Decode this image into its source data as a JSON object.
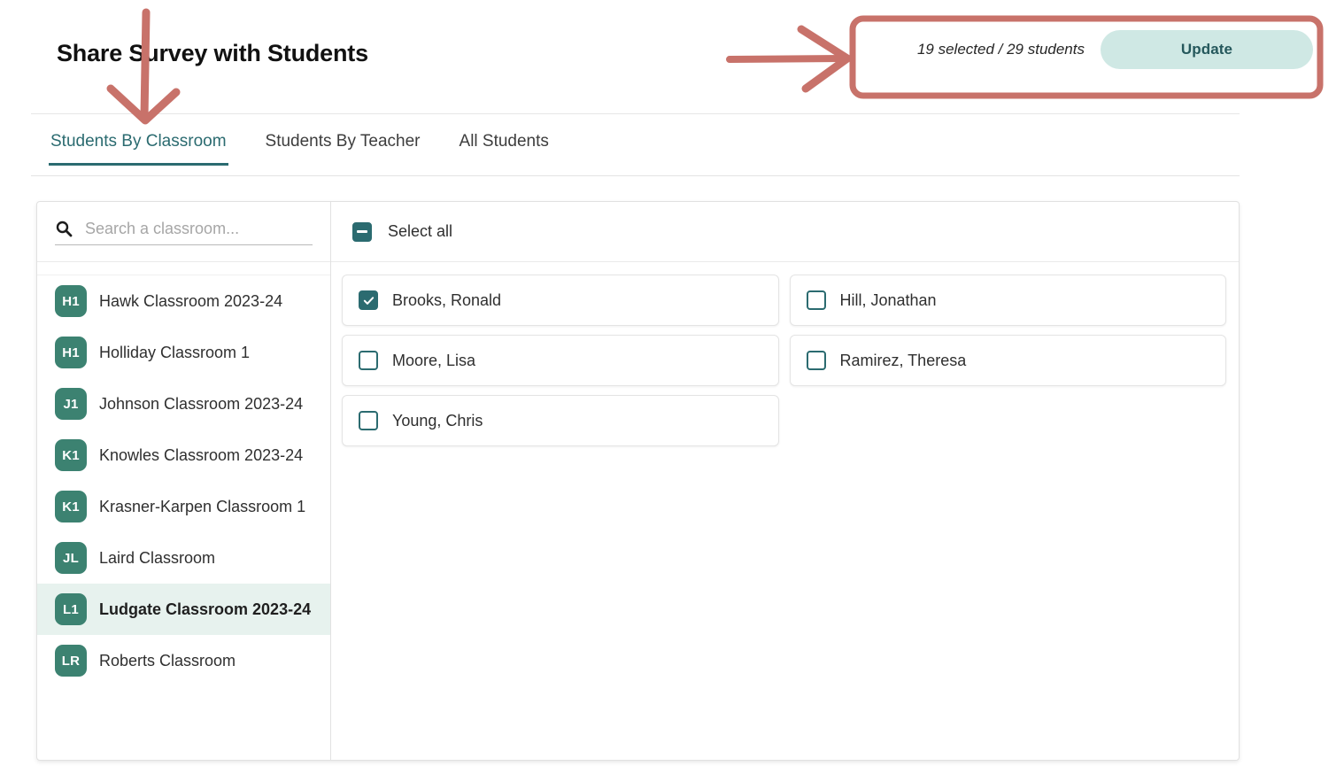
{
  "header": {
    "title": "Share Survey with Students",
    "selection_status": "19 selected / 29 students",
    "update_label": "Update"
  },
  "tabs": [
    {
      "label": "Students By Classroom",
      "active": true
    },
    {
      "label": "Students By Teacher",
      "active": false
    },
    {
      "label": "All Students",
      "active": false
    }
  ],
  "classroom_pane": {
    "search_placeholder": "Search a classroom...",
    "search_value": "",
    "search_icon": "search-icon",
    "items": [
      {
        "initials": "H1",
        "name": "Hawk Classroom 2023-24",
        "selected": false
      },
      {
        "initials": "H1",
        "name": "Holliday Classroom 1",
        "selected": false
      },
      {
        "initials": "J1",
        "name": "Johnson Classroom 2023-24",
        "selected": false
      },
      {
        "initials": "K1",
        "name": "Knowles Classroom 2023-24",
        "selected": false
      },
      {
        "initials": "K1",
        "name": "Krasner-Karpen Classroom 1",
        "selected": false
      },
      {
        "initials": "JL",
        "name": "Laird Classroom",
        "selected": false
      },
      {
        "initials": "L1",
        "name": "Ludgate Classroom 2023-24",
        "selected": true
      },
      {
        "initials": "LR",
        "name": "Roberts Classroom",
        "selected": false
      }
    ]
  },
  "students_pane": {
    "select_all_label": "Select all",
    "select_all_state": "indeterminate",
    "students": [
      {
        "name": "Brooks, Ronald",
        "checked": true
      },
      {
        "name": "Hill, Jonathan",
        "checked": false
      },
      {
        "name": "Moore, Lisa",
        "checked": false
      },
      {
        "name": "Ramirez, Theresa",
        "checked": false
      },
      {
        "name": "Young, Chris",
        "checked": false
      }
    ]
  },
  "annotations": {
    "color": "#c8726a",
    "down_arrow": "down-arrow-annotation",
    "right_arrow": "right-arrow-annotation",
    "highlight_box": "highlight-box-annotation"
  },
  "colors": {
    "accent_teal": "#2b6b70",
    "avatar_green": "#3c8271",
    "button_mint": "#cfe8e4",
    "selected_row": "#e7f2ee",
    "annotation_red": "#c8726a"
  }
}
